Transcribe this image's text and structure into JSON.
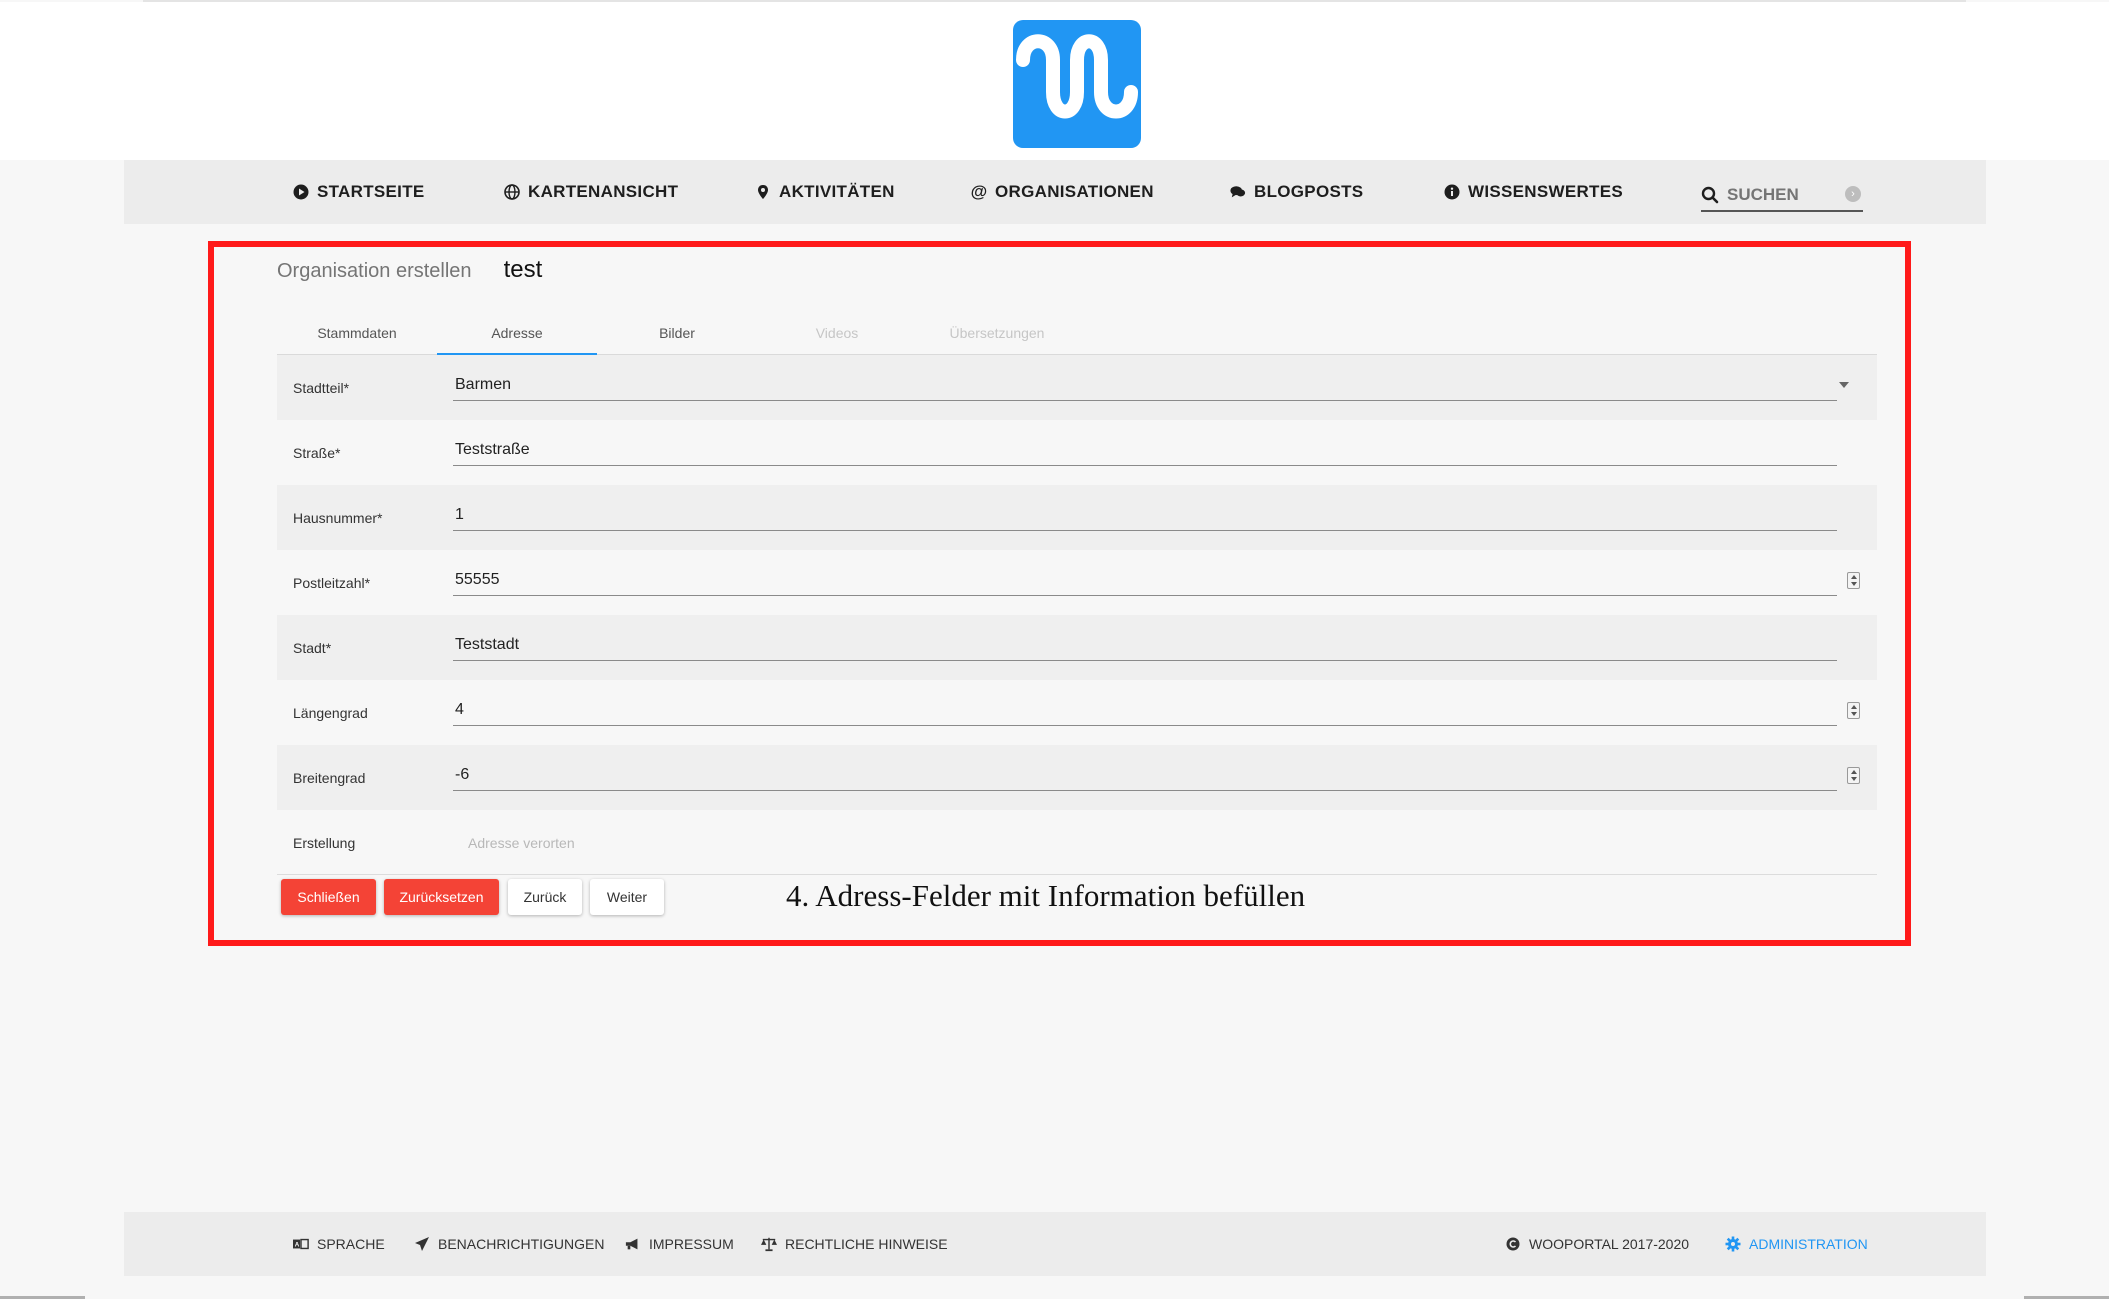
{
  "app": {
    "logo_name": "wooportal-logo",
    "accent": "#2196f3",
    "annotation_color": "#ff1a1a",
    "danger": "#f44336"
  },
  "nav": {
    "items": [
      {
        "label": "STARTSEITE",
        "icon": "play-circle-icon"
      },
      {
        "label": "KARTENANSICHT",
        "icon": "globe-icon"
      },
      {
        "label": "AKTIVITÄTEN",
        "icon": "map-marker-icon"
      },
      {
        "label": "ORGANISATIONEN",
        "icon": "at-icon"
      },
      {
        "label": "BLOGPOSTS",
        "icon": "comments-icon"
      },
      {
        "label": "WISSENSWERTES",
        "icon": "info-circle-icon"
      }
    ],
    "search": {
      "label": "SUCHEN",
      "icon": "search-icon"
    }
  },
  "page": {
    "title": "Organisation erstellen",
    "name": "test"
  },
  "tabs": [
    {
      "label": "Stammdaten",
      "state": "normal"
    },
    {
      "label": "Adresse",
      "state": "active"
    },
    {
      "label": "Bilder",
      "state": "normal"
    },
    {
      "label": "Videos",
      "state": "disabled"
    },
    {
      "label": "Übersetzungen",
      "state": "disabled"
    }
  ],
  "form": {
    "district": {
      "label": "Stadtteil*",
      "value": "Barmen"
    },
    "street": {
      "label": "Straße*",
      "value": "Teststraße"
    },
    "house_number": {
      "label": "Hausnummer*",
      "value": "1"
    },
    "postal_code": {
      "label": "Postleitzahl*",
      "value": "55555"
    },
    "city": {
      "label": "Stadt*",
      "value": "Teststadt"
    },
    "longitude": {
      "label": "Längengrad",
      "value": "4"
    },
    "latitude": {
      "label": "Breitengrad",
      "value": "-6"
    },
    "creation": {
      "label": "Erstellung",
      "link": "Adresse verorten"
    }
  },
  "actions": {
    "close": "Schließen",
    "reset": "Zurücksetzen",
    "back": "Zurück",
    "next": "Weiter"
  },
  "annotation": {
    "caption": "4. Adress-Felder mit Information befüllen"
  },
  "footer": {
    "language": "SPRACHE",
    "notifications": "BENACHRICHTIGUNGEN",
    "imprint": "IMPRESSUM",
    "legal": "RECHTLICHE HINWEISE",
    "copyright": "WOOPORTAL 2017-2020",
    "admin": "ADMINISTRATION"
  }
}
